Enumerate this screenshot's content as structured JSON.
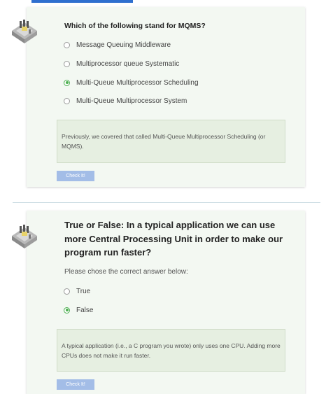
{
  "question1": {
    "text": "Which of the following stand for MQMS?",
    "options": [
      {
        "label": "Message Queuing Middleware",
        "selected": false
      },
      {
        "label": "Multiprocessor queue Systematic",
        "selected": false
      },
      {
        "label": "Multi-Queue Multiprocessor Scheduling",
        "selected": true
      },
      {
        "label": "Multi-Queue Multiprocessor System",
        "selected": false
      }
    ],
    "feedback": "Previously, we covered that called Multi-Queue Multiprocessor Scheduling (or MQMS).",
    "button_label": "Check It!"
  },
  "question2": {
    "text": "True or False: In a typical application we can use more Central Processing Unit in order to make our program run faster?",
    "prompt": "Please chose the correct answer below:",
    "options": [
      {
        "label": "True",
        "selected": false
      },
      {
        "label": "False",
        "selected": true
      }
    ],
    "feedback": "A typical application (i.e., a C program you wrote) only uses one CPU. Adding more CPUs does not make it run faster.",
    "button_label": "Check It!"
  },
  "icons": {
    "question_icon": "processor-chip-icon"
  },
  "colors": {
    "accent": "#2f6fcf",
    "selected": "#4caf50",
    "card": "#f3f8f2",
    "button": "#a3bde7"
  }
}
